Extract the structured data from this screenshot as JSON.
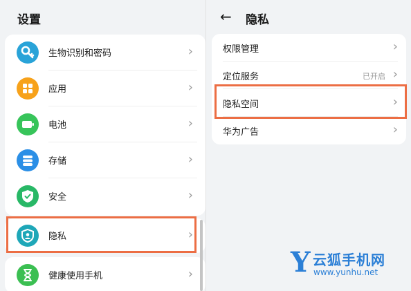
{
  "left": {
    "title": "设置",
    "items": [
      {
        "label": "生物识别和密码",
        "icon": "key-icon",
        "color": "#29a3d8"
      },
      {
        "label": "应用",
        "icon": "apps-grid-icon",
        "color": "#f7a21b"
      },
      {
        "label": "电池",
        "icon": "battery-icon",
        "color": "#37c45a"
      },
      {
        "label": "存储",
        "icon": "storage-icon",
        "color": "#2b8fe6"
      },
      {
        "label": "安全",
        "icon": "shield-check-icon",
        "color": "#28b866"
      },
      {
        "label": "隐私",
        "icon": "privacy-shield-icon",
        "color": "#1ea7b8"
      },
      {
        "label": "健康使用手机",
        "icon": "hourglass-icon",
        "color": "#3bbf52"
      }
    ],
    "highlighted_item": "隐私"
  },
  "right": {
    "title": "隐私",
    "back_icon": "back-arrow-icon",
    "items": [
      {
        "label": "权限管理",
        "status": ""
      },
      {
        "label": "定位服务",
        "status": "已开启"
      },
      {
        "label": "隐私空间",
        "status": ""
      },
      {
        "label": "华为广告",
        "status": ""
      }
    ],
    "highlighted_item": "隐私空间"
  },
  "watermark": {
    "letter": "Y",
    "name": "云狐手机网",
    "url": "www.yunhu.net"
  },
  "colors": {
    "highlight": "#ec6e44",
    "background": "#f1f3f5",
    "watermark": "#2b7fd6"
  }
}
